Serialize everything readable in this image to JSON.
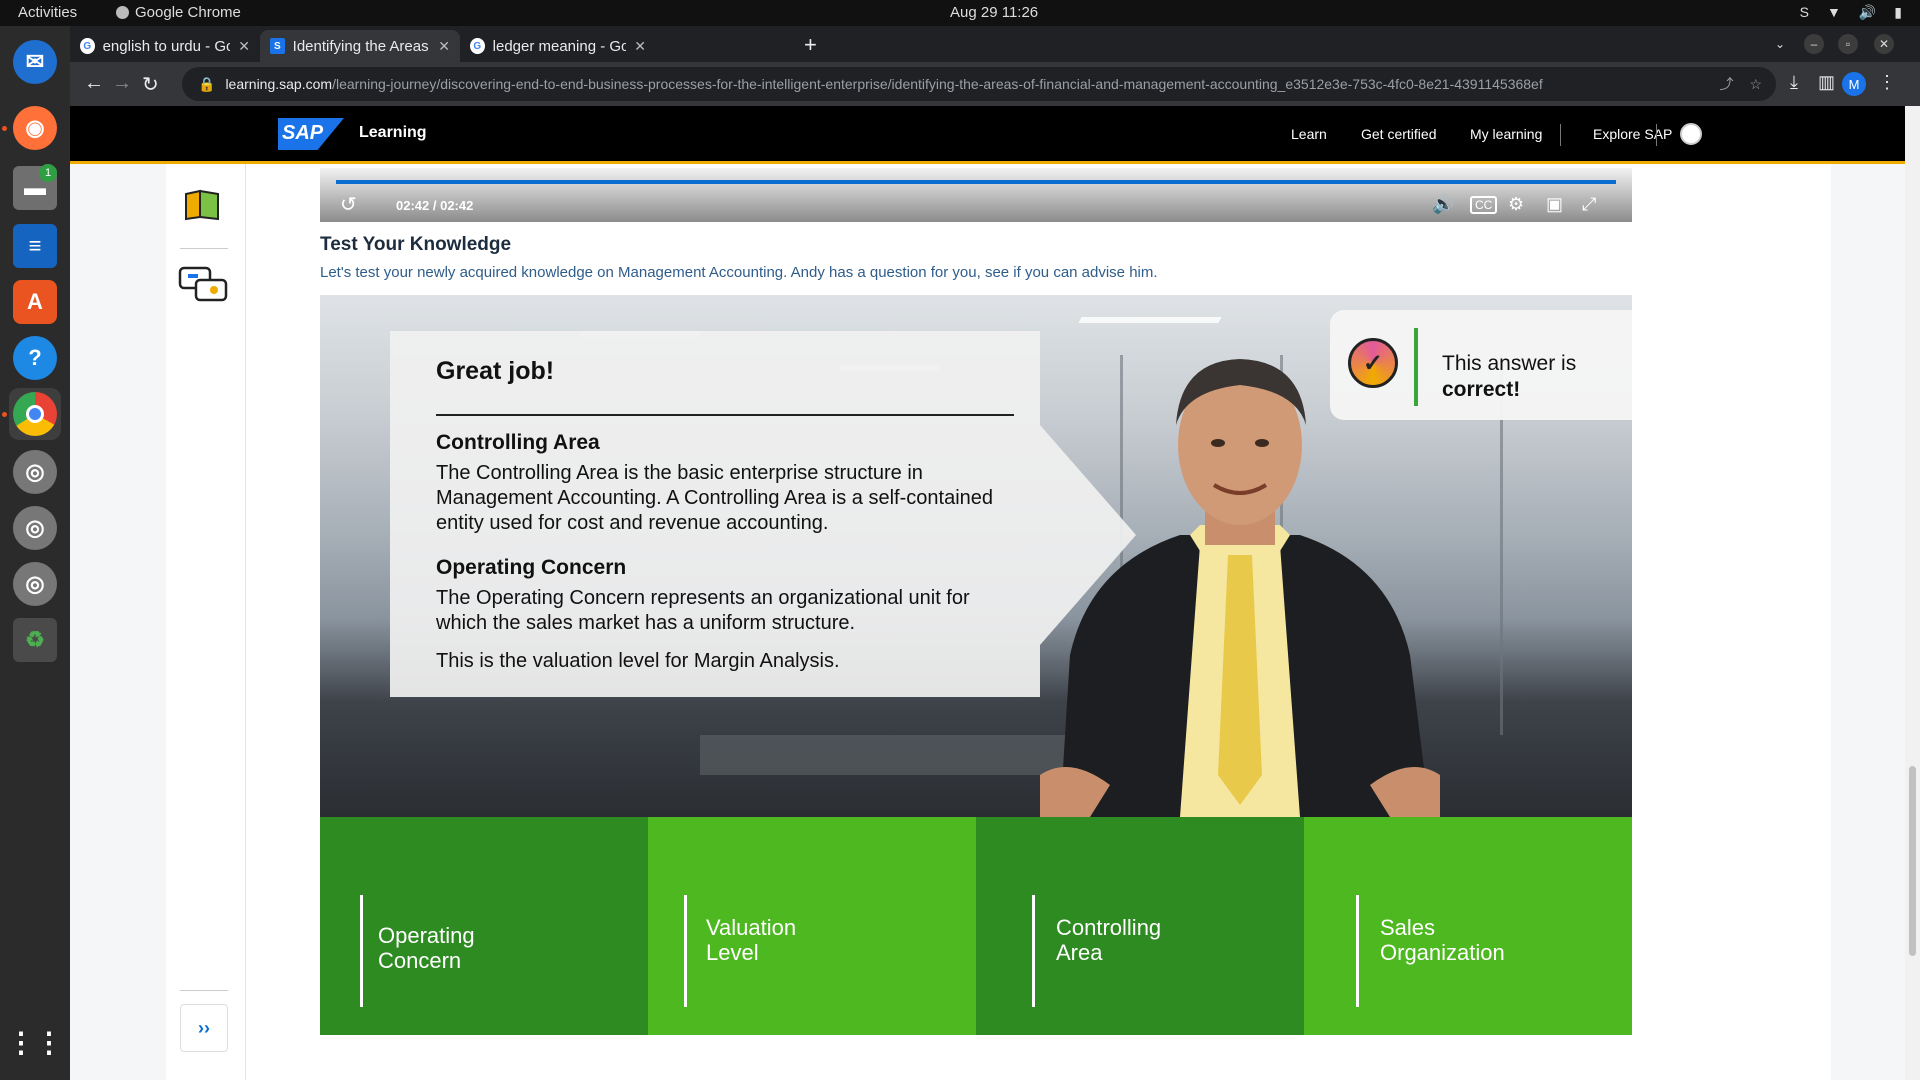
{
  "topbar": {
    "activities": "Activities",
    "app_name": "Google Chrome",
    "clock": "Aug 29  11:26"
  },
  "dock": {
    "files_badge": "1"
  },
  "browser": {
    "tabs": [
      {
        "title": "english to urdu - Google S",
        "favicon": "google-icon"
      },
      {
        "title": "Identifying the Areas of Fi",
        "favicon": "sap-icon"
      },
      {
        "title": "ledger meaning - Google S",
        "favicon": "google-icon"
      }
    ],
    "url_domain": "learning.sap.com",
    "url_path": "/learning-journey/discovering-end-to-end-business-processes-for-the-intelligent-enterprise/identifying-the-areas-of-financial-and-management-accounting_e3512e3e-753c-4fc0-8e21-4391145368ef",
    "profile_initial": "M"
  },
  "sap": {
    "logo": "SAP",
    "brand": "Learning",
    "nav": [
      "Learn",
      "Get certified",
      "My learning",
      "Explore SAP"
    ]
  },
  "video": {
    "time": "02:42 / 02:42",
    "progress": 1.0
  },
  "lesson": {
    "title": "Test Your Knowledge",
    "description": "Let's test your newly acquired knowledge on Management Accounting. Andy has a question for you, see if you can advise him."
  },
  "feedback": {
    "heading": "Great job!",
    "sections": [
      {
        "title": "Controlling Area",
        "text": "The Controlling Area is the basic enterprise structure in Management Accounting. A Controlling Area is a self-contained entity used for cost and revenue accounting."
      },
      {
        "title": "Operating Concern",
        "text": "The Operating Concern represents an organizational unit for which the sales market has a uniform structure."
      }
    ],
    "extra": "This is the valuation level for Margin Analysis."
  },
  "answer": {
    "line1": "This answer is",
    "line2": "correct!"
  },
  "options": [
    {
      "label": "Operating Concern",
      "color": "#2e8b22"
    },
    {
      "label": "Valuation Level",
      "color": "#4db820"
    },
    {
      "label": "Controlling Area",
      "color": "#2e8b22"
    },
    {
      "label": "Sales Organization",
      "color": "#4db820"
    }
  ]
}
